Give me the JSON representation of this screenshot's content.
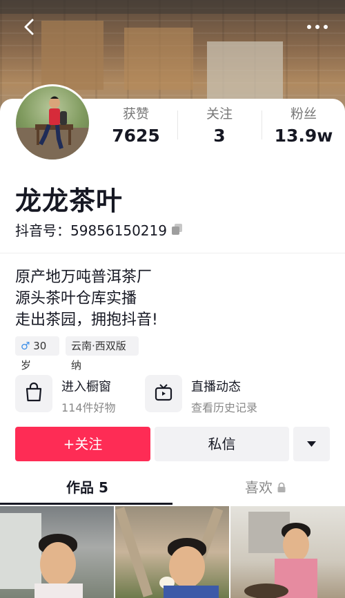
{
  "stats": [
    {
      "label": "获赞",
      "value": "7625"
    },
    {
      "label": "关注",
      "value": "3"
    },
    {
      "label": "粉丝",
      "value": "13.9w"
    }
  ],
  "profile": {
    "name": "龙龙茶叶",
    "douyin_id": "抖音号：59856150219",
    "bio": [
      "原产地万吨普洱茶厂",
      "源头茶叶仓库实播",
      "走出茶园，拥抱抖音!"
    ],
    "tags": [
      "30岁",
      "云南·西双版纳"
    ]
  },
  "features": [
    {
      "title": "进入橱窗",
      "subtitle": "114件好物",
      "icon": "shopping-bag-icon"
    },
    {
      "title": "直播动态",
      "subtitle": "查看历史记录",
      "icon": "tv-icon"
    }
  ],
  "actions": {
    "follow": "+关注",
    "message": "私信"
  },
  "tabs": [
    {
      "label": "作品 5",
      "active": true
    },
    {
      "label": "喜欢",
      "locked": true
    }
  ],
  "colors": {
    "accent": "#fe2c55",
    "text": "#161823",
    "muted": "#888888",
    "chip": "#f2f2f4"
  }
}
